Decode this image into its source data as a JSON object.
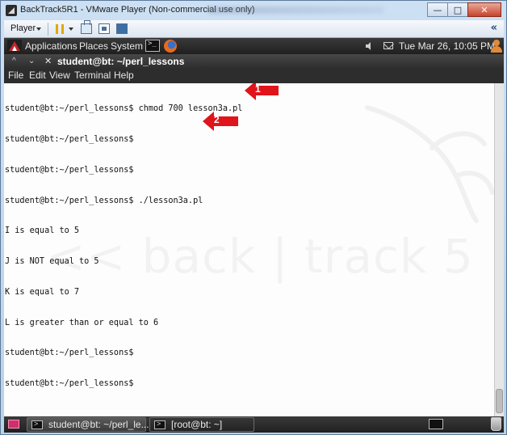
{
  "window": {
    "title": "BackTrack5R1 - VMware Player (Non-commercial use only)"
  },
  "vmware_toolbar": {
    "player_label": "Player"
  },
  "top_panel": {
    "applications": "Applications",
    "places": "Places",
    "system": "System",
    "clock": "Tue Mar 26, 10:05 PM"
  },
  "terminal": {
    "title": "student@bt: ~/perl_lessons",
    "menu": [
      "File",
      "Edit",
      "View",
      "Terminal",
      "Help"
    ],
    "lines": [
      "student@bt:~/perl_lessons$ chmod 700 lesson3a.pl",
      "student@bt:~/perl_lessons$",
      "student@bt:~/perl_lessons$",
      "student@bt:~/perl_lessons$ ./lesson3a.pl",
      "I is equal to 5",
      "J is NOT equal to 5",
      "K is equal to 7",
      "L is greater than or equal to 6",
      "student@bt:~/perl_lessons$",
      "student@bt:~/perl_lessons$"
    ],
    "watermark": "<< back | track 5"
  },
  "annotations": [
    {
      "number": "1",
      "color": "#e0141b"
    },
    {
      "number": "2",
      "color": "#e0141b"
    }
  ],
  "bottom_panel": {
    "tasks": [
      {
        "label": "student@bt: ~/perl_le..."
      },
      {
        "label": "[root@bt: ~]"
      }
    ]
  }
}
